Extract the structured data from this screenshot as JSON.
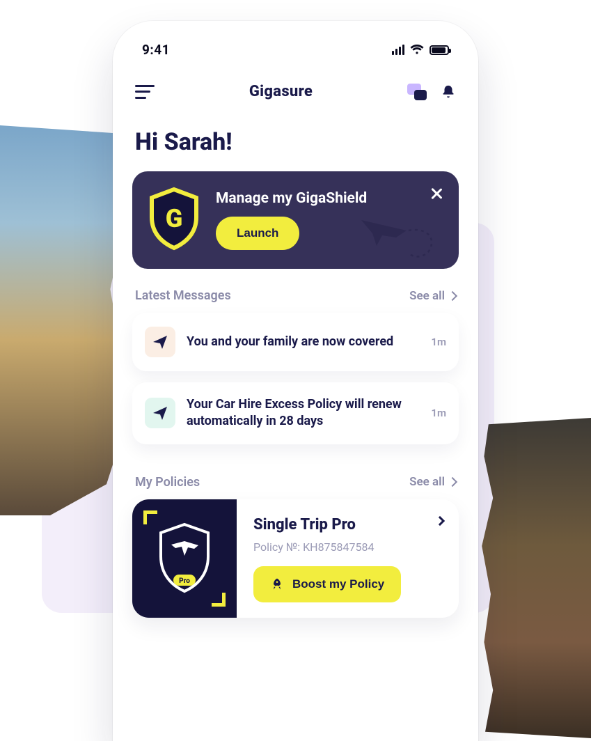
{
  "status": {
    "time": "9:41"
  },
  "header": {
    "brand": "Gigasure"
  },
  "greeting": "Hi Sarah!",
  "banner": {
    "title": "Manage my GigaShield",
    "button_label": "Launch",
    "logo_letter": "G"
  },
  "messages": {
    "heading": "Latest Messages",
    "see_all": "See all",
    "items": [
      {
        "text": "You and your family are now covered",
        "time": "1m",
        "icon_bg": "peach"
      },
      {
        "text": "Your Car Hire Excess Policy will renew automatically in 28 days",
        "time": "1m",
        "icon_bg": "mint"
      }
    ]
  },
  "policies": {
    "heading": "My Policies",
    "see_all": "See all",
    "items": [
      {
        "name": "Single Trip Pro",
        "policy_label": "Policy №: KH875847584",
        "boost_label": "Boost my Policy",
        "badge": "Pro"
      }
    ]
  }
}
